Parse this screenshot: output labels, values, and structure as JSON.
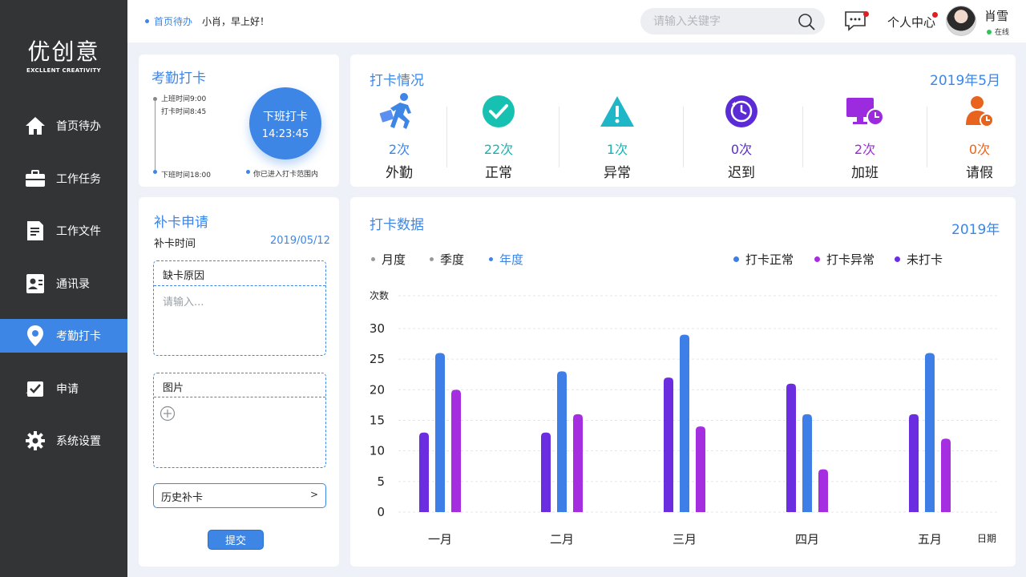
{
  "app": {
    "logo": "优创意",
    "logo_sub": "EXCLLENT CREATIVITY"
  },
  "sidebar": {
    "items": [
      {
        "label": "首页待办",
        "icon": "home-icon",
        "active": false
      },
      {
        "label": "工作任务",
        "icon": "briefcase-icon",
        "active": false
      },
      {
        "label": "工作文件",
        "icon": "document-icon",
        "active": false
      },
      {
        "label": "通讯录",
        "icon": "contacts-icon",
        "active": false
      },
      {
        "label": "考勤打卡",
        "icon": "location-pin-icon",
        "active": true
      },
      {
        "label": "申请",
        "icon": "approval-icon",
        "active": false
      },
      {
        "label": "系统设置",
        "icon": "gear-icon",
        "active": false
      }
    ]
  },
  "topbar": {
    "breadcrumb": "首页待办",
    "greeting": "小肖，早上好！",
    "search_placeholder": "请输入关键字",
    "center_label": "个人中心",
    "user_name": "肖雪",
    "user_status": "在线"
  },
  "attendance": {
    "title": "考勤打卡",
    "work_start": "上班时间9:00",
    "clock_in": "打卡时间8:45",
    "work_end": "下班时间18:00",
    "button_label": "下班打卡",
    "button_time": "14:23:45",
    "range_note": "你已进入打卡范围内"
  },
  "summary": {
    "title": "打卡情况",
    "period": "2019年5月",
    "stats": [
      {
        "value": "2次",
        "label": "外勤",
        "icon": "field-work-icon",
        "color": "#3d86e6"
      },
      {
        "value": "22次",
        "label": "正常",
        "icon": "check-circle-icon",
        "color": "#17b3b3"
      },
      {
        "value": "1次",
        "label": "异常",
        "icon": "warning-icon",
        "color": "#17b3b3"
      },
      {
        "value": "0次",
        "label": "迟到",
        "icon": "late-clock-icon",
        "color": "#5b2bd6"
      },
      {
        "value": "2次",
        "label": "加班",
        "icon": "overtime-monitor-icon",
        "color": "#9c2be0"
      },
      {
        "value": "0次",
        "label": "请假",
        "icon": "leave-person-icon",
        "color": "#e8641e"
      }
    ]
  },
  "supplement": {
    "title": "补卡申请",
    "time_label": "补卡时间",
    "time_value": "2019/05/12",
    "reason_label": "缺卡原因",
    "reason_placeholder": "请输入...",
    "image_label": "图片",
    "history_label": "历史补卡",
    "history_arrow": ">",
    "submit_label": "提交"
  },
  "chart_section": {
    "title": "打卡数据",
    "year": "2019年",
    "tabs": [
      {
        "label": "月度",
        "active": false
      },
      {
        "label": "季度",
        "active": false
      },
      {
        "label": "年度",
        "active": true
      }
    ]
  },
  "chart_data": {
    "type": "bar",
    "ylabel": "次数",
    "xlabel": "日期",
    "ylim": [
      0,
      30
    ],
    "yticks": [
      0,
      5,
      10,
      15,
      20,
      25,
      30
    ],
    "categories": [
      "一月",
      "二月",
      "三月",
      "四月",
      "五月"
    ],
    "series": [
      {
        "name": "未打卡",
        "color": "#6a2ee0",
        "values": [
          13,
          13,
          22,
          21,
          16
        ]
      },
      {
        "name": "打卡正常",
        "color": "#3d7fe6",
        "values": [
          26,
          23,
          29,
          16,
          26
        ]
      },
      {
        "name": "打卡异常",
        "color": "#a42ee0",
        "values": [
          20,
          16,
          14,
          7,
          12
        ]
      }
    ],
    "legend_order": [
      "打卡正常",
      "打卡异常",
      "未打卡"
    ],
    "legend_position": "top-right",
    "grid": true
  }
}
